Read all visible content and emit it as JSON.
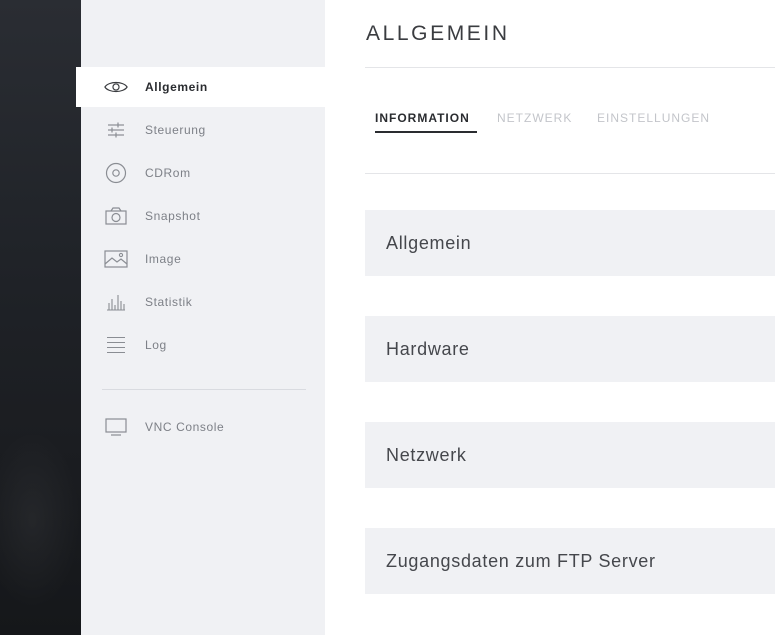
{
  "sidebar": {
    "items": [
      {
        "label": "Allgemein",
        "icon": "eye-icon",
        "active": true
      },
      {
        "label": "Steuerung",
        "icon": "sliders-icon"
      },
      {
        "label": "CDRom",
        "icon": "disc-icon"
      },
      {
        "label": "Snapshot",
        "icon": "camera-icon"
      },
      {
        "label": "Image",
        "icon": "image-icon"
      },
      {
        "label": "Statistik",
        "icon": "bar-chart-icon"
      },
      {
        "label": "Log",
        "icon": "list-icon"
      }
    ],
    "console": {
      "label": "VNC Console",
      "icon": "monitor-icon"
    }
  },
  "main": {
    "title": "ALLGEMEIN",
    "tabs": [
      {
        "label": "INFORMATION",
        "active": true
      },
      {
        "label": "NETZWERK"
      },
      {
        "label": "EINSTELLUNGEN"
      }
    ],
    "panels": [
      {
        "title": "Allgemein"
      },
      {
        "title": "Hardware"
      },
      {
        "title": "Netzwerk"
      },
      {
        "title": "Zugangsdaten zum FTP Server"
      }
    ]
  },
  "colors": {
    "dark_strip": "#1f2227",
    "sidebar_bg": "#f0f1f4",
    "active_text": "#2a2c30",
    "muted_text": "#7d8087",
    "inactive_tab": "#c3c5ca",
    "panel_bg": "#f0f1f4"
  }
}
